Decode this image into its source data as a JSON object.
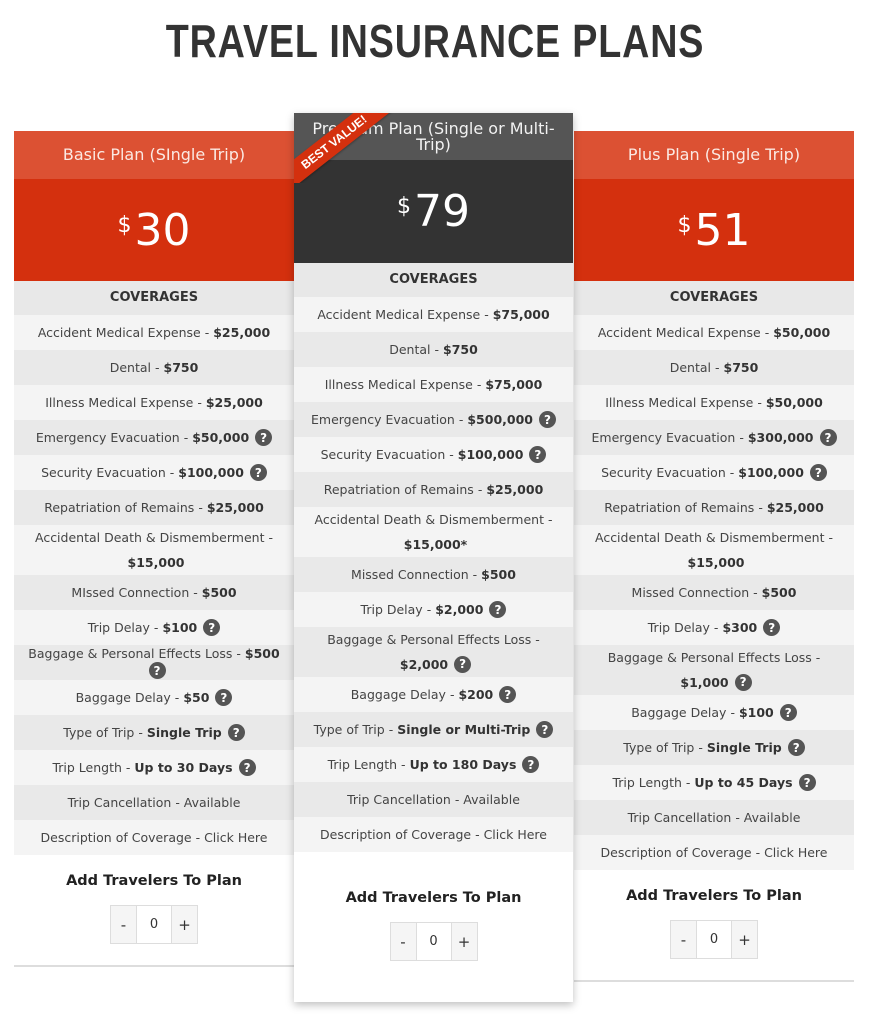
{
  "page_title": "TRAVEL INSURANCE PLANS",
  "badge": "BEST VALUE!",
  "coverage_header": "COVERAGES",
  "travelers_title": "Add Travelers To Plan",
  "stepper": {
    "minus": "-",
    "plus": "+",
    "help_glyph": "?"
  },
  "colors": {
    "accent": "#d4300e",
    "accent_header": "#dc5133",
    "featured_header": "#555555",
    "featured_price": "#333333"
  },
  "plans": [
    {
      "name": "Basic Plan (SIngle Trip)",
      "currency": "$",
      "price": "30",
      "quantity": "0",
      "rows": [
        {
          "label": "Accident Medical Expense",
          "sep": "-",
          "value": "$25,000",
          "help": false
        },
        {
          "label": "Dental",
          "sep": "-",
          "value": "$750",
          "help": false
        },
        {
          "label": "Illness Medical Expense",
          "sep": "-",
          "value": "$25,000",
          "help": false
        },
        {
          "label": "Emergency Evacuation",
          "sep": "-",
          "value": "$50,000",
          "help": true
        },
        {
          "label": "Security Evacuation",
          "sep": "-",
          "value": "$100,000",
          "help": true
        },
        {
          "label": "Repatriation of Remains",
          "sep": "-",
          "value": "$25,000",
          "help": false
        },
        {
          "label": "Accidental Death & Dismemberment",
          "sep": "-",
          "value": "$15,000",
          "help": false
        },
        {
          "label": "MIssed Connection",
          "sep": "-",
          "value": "$500",
          "help": false
        },
        {
          "label": "Trip Delay",
          "sep": "-",
          "value": "$100",
          "help": true
        },
        {
          "label": "Baggage & Personal Effects Loss",
          "sep": "-",
          "value": "$500",
          "help": true
        },
        {
          "label": "Baggage Delay",
          "sep": "-",
          "value": "$50",
          "help": true
        },
        {
          "label": "Type of Trip",
          "sep": "-",
          "value": "Single Trip",
          "help": true
        },
        {
          "label": "Trip Length",
          "sep": "-",
          "value": "Up to 30 Days",
          "help": true
        },
        {
          "label": "Trip Cancellation - Available",
          "sep": "",
          "value": "",
          "help": false
        },
        {
          "label": "Description of Coverage - Click Here",
          "sep": "",
          "value": "",
          "help": false,
          "link": true
        }
      ]
    },
    {
      "name": "Premium Plan (Single or Multi-Trip)",
      "currency": "$",
      "price": "79",
      "quantity": "0",
      "rows": [
        {
          "label": "Accident Medical Expense",
          "sep": "-",
          "value": "$75,000",
          "help": false
        },
        {
          "label": "Dental",
          "sep": "-",
          "value": "$750",
          "help": false
        },
        {
          "label": "Illness Medical Expense",
          "sep": "-",
          "value": "$75,000",
          "help": false
        },
        {
          "label": "Emergency Evacuation",
          "sep": "-",
          "value": "$500,000",
          "help": true
        },
        {
          "label": "Security Evacuation",
          "sep": "-",
          "value": "$100,000",
          "help": true
        },
        {
          "label": "Repatriation of Remains",
          "sep": "-",
          "value": "$25,000",
          "help": false
        },
        {
          "label": "Accidental Death & Dismemberment",
          "sep": "-",
          "value": "$15,000*",
          "help": false
        },
        {
          "label": "Missed Connection",
          "sep": "-",
          "value": "$500",
          "help": false
        },
        {
          "label": "Trip Delay",
          "sep": "-",
          "value": "$2,000",
          "help": true
        },
        {
          "label": "Baggage & Personal Effects Loss",
          "sep": "-",
          "value": "$2,000",
          "help": true
        },
        {
          "label": "Baggage Delay",
          "sep": "-",
          "value": "$200",
          "help": true
        },
        {
          "label": "Type of Trip",
          "sep": "-",
          "value": "Single or Multi-Trip",
          "help": true
        },
        {
          "label": "Trip Length",
          "sep": "-",
          "value": "Up to 180 Days",
          "help": true
        },
        {
          "label": "Trip Cancellation - Available",
          "sep": "",
          "value": "",
          "help": false
        },
        {
          "label": "Description of Coverage - Click Here",
          "sep": "",
          "value": "",
          "help": false,
          "link": true
        }
      ]
    },
    {
      "name": "Plus Plan (Single Trip)",
      "currency": "$",
      "price": "51",
      "quantity": "0",
      "rows": [
        {
          "label": "Accident Medical Expense",
          "sep": "-",
          "value": "$50,000",
          "help": false
        },
        {
          "label": "Dental",
          "sep": "-",
          "value": "$750",
          "help": false
        },
        {
          "label": "Illness Medical Expense",
          "sep": "-",
          "value": "$50,000",
          "help": false
        },
        {
          "label": "Emergency Evacuation",
          "sep": "-",
          "value": "$300,000",
          "help": true
        },
        {
          "label": "Security Evacuation",
          "sep": "-",
          "value": "$100,000",
          "help": true
        },
        {
          "label": "Repatriation of Remains",
          "sep": "-",
          "value": "$25,000",
          "help": false
        },
        {
          "label": "Accidental Death & Dismemberment",
          "sep": "-",
          "value": "$15,000",
          "help": false
        },
        {
          "label": "Missed Connection",
          "sep": "-",
          "value": "$500",
          "help": false
        },
        {
          "label": "Trip Delay",
          "sep": "-",
          "value": "$300",
          "help": true
        },
        {
          "label": "Baggage & Personal Effects Loss",
          "sep": "-",
          "value": "$1,000",
          "help": true
        },
        {
          "label": "Baggage Delay",
          "sep": "-",
          "value": "$100",
          "help": true
        },
        {
          "label": "Type of Trip",
          "sep": "-",
          "value": "Single Trip",
          "help": true
        },
        {
          "label": "Trip Length",
          "sep": "-",
          "value": "Up to 45 Days",
          "help": true
        },
        {
          "label": "Trip Cancellation - Available",
          "sep": "",
          "value": "",
          "help": false
        },
        {
          "label": "Description of Coverage - Click Here",
          "sep": "",
          "value": "",
          "help": false,
          "link": true
        }
      ]
    }
  ]
}
